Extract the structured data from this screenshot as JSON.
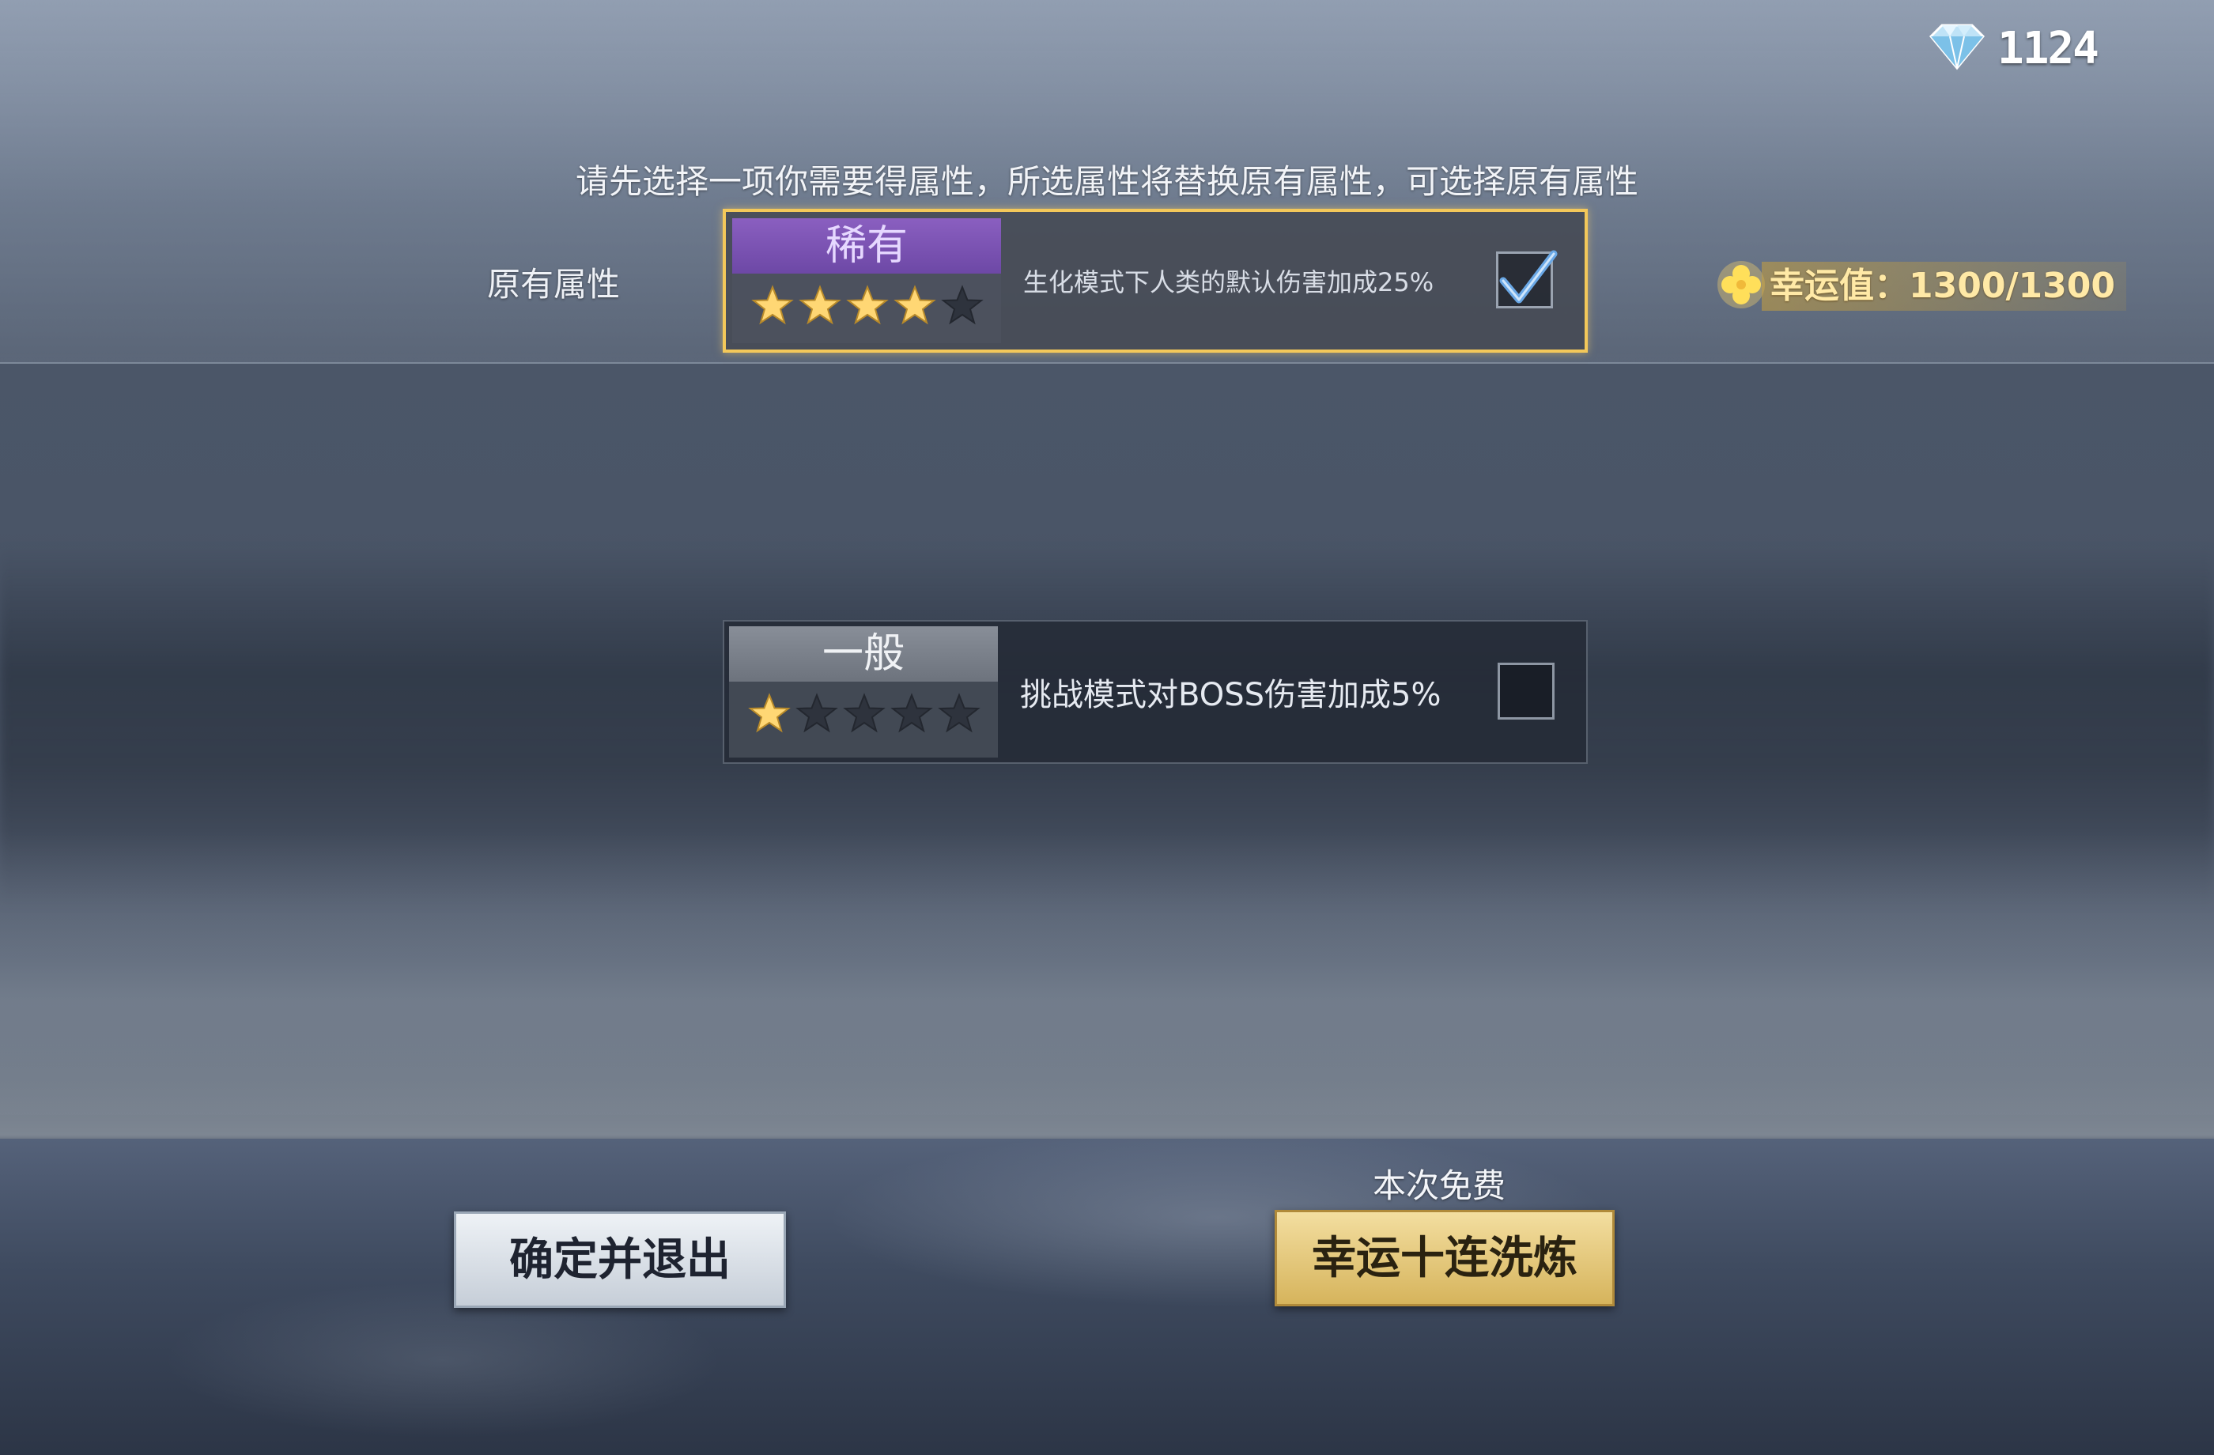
{
  "currency": {
    "icon": "diamond-icon",
    "value": "1124"
  },
  "instruction": "请先选择一项你需要得属性，所选属性将替换原有属性，可选择原有属性",
  "original_label": "原有属性",
  "original_attribute": {
    "rarity": "稀有",
    "stars": 4,
    "max_stars": 5,
    "description": "生化模式下人类的默认伤害加成25%",
    "checked": true
  },
  "new_attribute": {
    "rarity": "一般",
    "stars": 1,
    "max_stars": 5,
    "description": "挑战模式对BOSS伤害加成5%",
    "checked": false
  },
  "luck": {
    "icon": "clover-icon",
    "text": "幸运值：1300/1300"
  },
  "free_label": "本次免费",
  "buttons": {
    "exit": "确定并退出",
    "reroll": "幸运十连洗炼"
  },
  "colors": {
    "accent_gold": "#f3c85a",
    "rare_purple": "#7a52b4",
    "star_gold": "#ffd774"
  }
}
